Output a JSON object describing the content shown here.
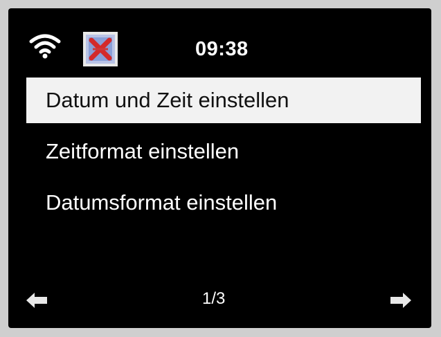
{
  "status_bar": {
    "time": "09:38",
    "wifi_icon": "wifi-icon",
    "station_icon": "station-image-icon"
  },
  "menu": {
    "items": [
      {
        "label": "Datum und Zeit einstellen",
        "selected": true
      },
      {
        "label": "Zeitformat einstellen",
        "selected": false
      },
      {
        "label": "Datumsformat einstellen",
        "selected": false
      }
    ]
  },
  "footer": {
    "page": "1/3",
    "prev_icon": "arrow-left-icon",
    "next_icon": "arrow-right-icon"
  },
  "colors": {
    "screen_background": "#000000",
    "highlight_background": "#f2f2f2",
    "highlight_text": "#111111",
    "text": "#ffffff"
  }
}
